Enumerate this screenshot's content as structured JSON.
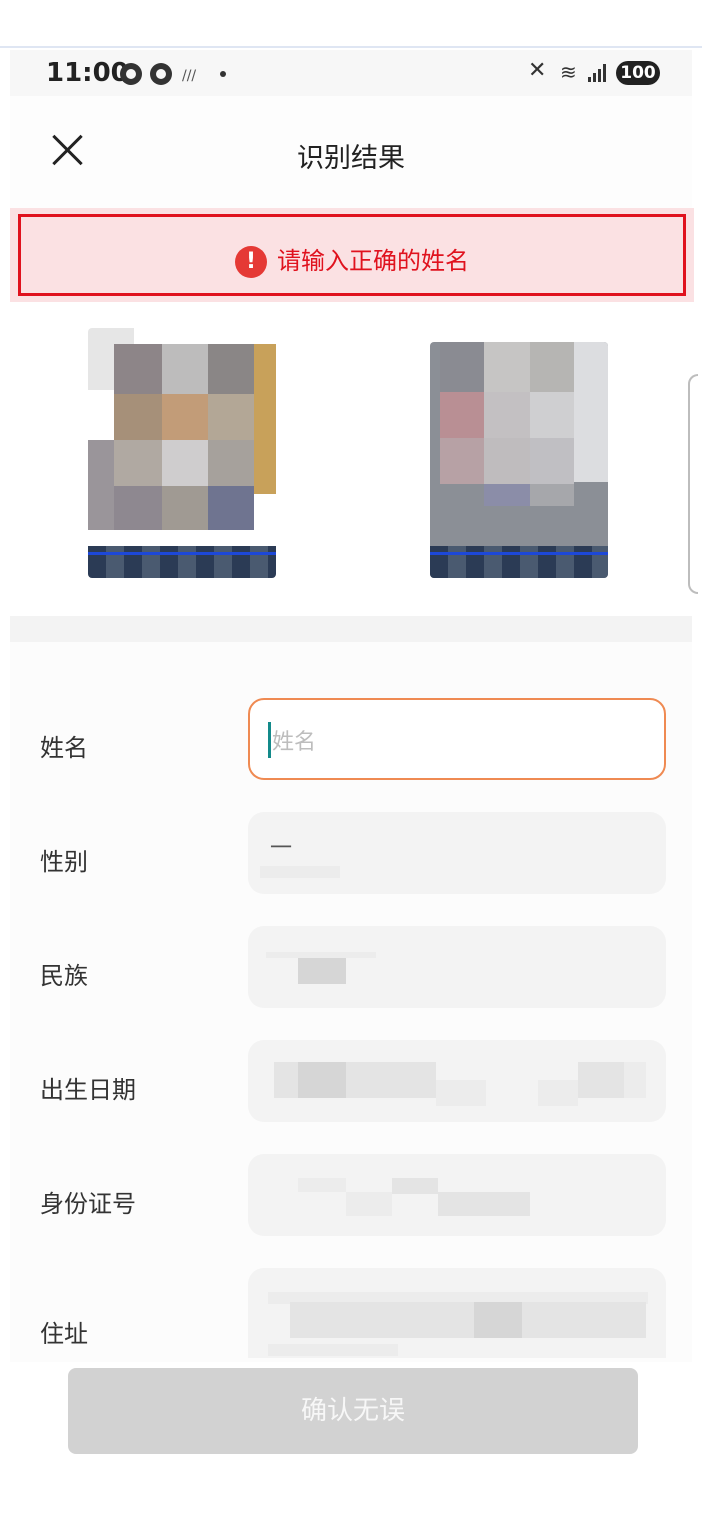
{
  "status_bar": {
    "time": "11:00",
    "battery": "100"
  },
  "header": {
    "title": "识别结果"
  },
  "alert": {
    "message": "请输入正确的姓名"
  },
  "form": {
    "name_label": "姓名",
    "name_placeholder": "姓名",
    "gender_label": "性别",
    "gender_value": "一",
    "ethnicity_label": "民族",
    "birthdate_label": "出生日期",
    "id_number_label": "身份证号",
    "address_label": "住址"
  },
  "confirm_button": {
    "label": "确认无误"
  },
  "colors": {
    "alert_red": "#e0121e",
    "alert_bg": "#fbe1e3",
    "focus_orange": "#ef8a52",
    "button_disabled": "#d2d2d2"
  }
}
